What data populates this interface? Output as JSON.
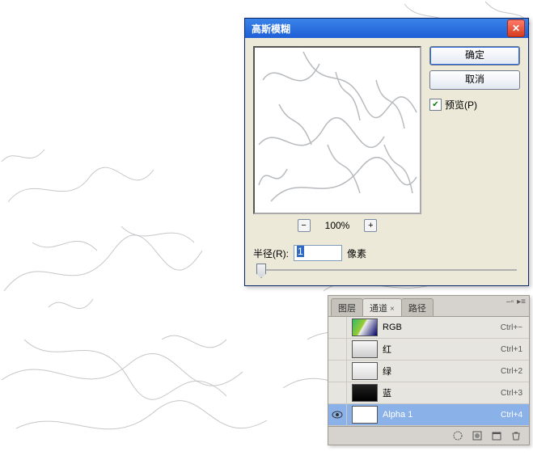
{
  "dialog": {
    "title": "高斯模糊",
    "ok": "确定",
    "cancel": "取消",
    "preview_label": "预览(P)",
    "preview_checked": true,
    "zoom_label": "100%",
    "radius_label": "半径(R):",
    "radius_value": "1",
    "radius_unit": "像素"
  },
  "panel": {
    "tabs": [
      {
        "label": "图层",
        "active": false
      },
      {
        "label": "通道",
        "active": true
      },
      {
        "label": "路径",
        "active": false
      }
    ],
    "channels": [
      {
        "name": "RGB",
        "shortcut": "Ctrl+~",
        "kind": "rgb",
        "eye": false,
        "selected": false
      },
      {
        "name": "红",
        "shortcut": "Ctrl+1",
        "kind": "red",
        "eye": false,
        "selected": false
      },
      {
        "name": "绿",
        "shortcut": "Ctrl+2",
        "kind": "green",
        "eye": false,
        "selected": false
      },
      {
        "name": "蓝",
        "shortcut": "Ctrl+3",
        "kind": "blue",
        "eye": false,
        "selected": false
      },
      {
        "name": "Alpha 1",
        "shortcut": "Ctrl+4",
        "kind": "alpha",
        "eye": true,
        "selected": true
      }
    ]
  }
}
